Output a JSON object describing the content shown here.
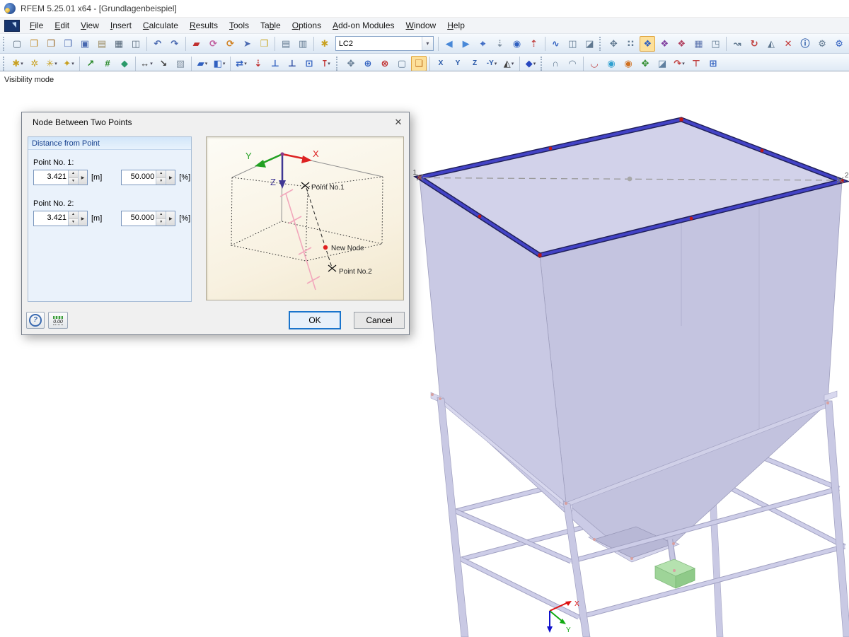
{
  "window": {
    "title": "RFEM 5.25.01 x64 - [Grundlagenbeispiel]"
  },
  "menu": {
    "items": [
      {
        "label": "File",
        "u": 0
      },
      {
        "label": "Edit",
        "u": 0
      },
      {
        "label": "View",
        "u": 0
      },
      {
        "label": "Insert",
        "u": 0
      },
      {
        "label": "Calculate",
        "u": 0
      },
      {
        "label": "Results",
        "u": 0
      },
      {
        "label": "Tools",
        "u": 0
      },
      {
        "label": "Table",
        "u": 2
      },
      {
        "label": "Options",
        "u": 0
      },
      {
        "label": "Add-on Modules",
        "u": 0
      },
      {
        "label": "Window",
        "u": 0
      },
      {
        "label": "Help",
        "u": 0
      }
    ]
  },
  "toolbars": {
    "load_case": "LC2",
    "row1": [
      {
        "t": "grip"
      },
      {
        "n": "new-model",
        "g": "▢",
        "c": "#56687a"
      },
      {
        "n": "open-model",
        "g": "❒",
        "c": "#c08a28"
      },
      {
        "n": "open-project-manager",
        "g": "❒",
        "c": "#9a6826"
      },
      {
        "n": "save-as-archive",
        "g": "❒",
        "c": "#4868b0"
      },
      {
        "n": "save",
        "g": "▣",
        "c": "#4868b0"
      },
      {
        "n": "page-setup",
        "g": "▤",
        "c": "#9a8a60"
      },
      {
        "n": "print",
        "g": "▦",
        "c": "#56687a"
      },
      {
        "n": "print-preview",
        "g": "◫",
        "c": "#56687a"
      },
      {
        "t": "sep"
      },
      {
        "n": "undo",
        "g": "↶",
        "c": "#4868b0"
      },
      {
        "n": "redo",
        "g": "↷",
        "c": "#4868b0"
      },
      {
        "t": "sep"
      },
      {
        "n": "select-by-window",
        "g": "▰",
        "c": "#c03030"
      },
      {
        "n": "rotate-view-mouse",
        "g": "⟳",
        "c": "#c060a0"
      },
      {
        "n": "rotate-view-axis",
        "g": "⟳",
        "c": "#d08020"
      },
      {
        "n": "pick-mode",
        "g": "➤",
        "c": "#4868b0"
      },
      {
        "n": "new-view-window",
        "g": "❒",
        "c": "#c8a828"
      },
      {
        "t": "sep"
      },
      {
        "n": "table-show",
        "g": "▤",
        "c": "#607890"
      },
      {
        "n": "table-position",
        "g": "▥",
        "c": "#607890"
      },
      {
        "t": "sep"
      },
      {
        "n": "new-load-case",
        "g": "✱",
        "c": "#c8a020"
      },
      {
        "t": "combo"
      },
      {
        "t": "sep"
      },
      {
        "n": "previous-load-case",
        "g": "◀",
        "c": "#4888d8"
      },
      {
        "n": "next-load-case",
        "g": "▶",
        "c": "#4888d8"
      },
      {
        "n": "show-loads",
        "g": "⌖",
        "c": "#3060c0"
      },
      {
        "n": "show-load-values",
        "g": "⇣",
        "c": "#8090a0"
      },
      {
        "n": "show-results",
        "g": "◉",
        "c": "#3060c0"
      },
      {
        "n": "show-result-values",
        "g": "⇡",
        "c": "#c04040"
      },
      {
        "t": "sep"
      },
      {
        "n": "member-releases",
        "g": "∿",
        "c": "#3060c0"
      },
      {
        "n": "display-properties",
        "g": "◫",
        "c": "#607890"
      },
      {
        "n": "comments",
        "g": "◪",
        "c": "#607890"
      },
      {
        "t": "grip"
      },
      {
        "n": "move-grab-mode",
        "g": "✥",
        "c": "#607890"
      },
      {
        "n": "snap-grid",
        "g": "∷",
        "c": "#607890"
      },
      {
        "n": "visibility-mode",
        "g": "❖",
        "c": "#3060c0",
        "hl": 1
      },
      {
        "n": "visibility-by-window",
        "g": "❖",
        "c": "#8040a0"
      },
      {
        "n": "visibility-inverted",
        "g": "❖",
        "c": "#b04060"
      },
      {
        "n": "visibility-by-numbering",
        "g": "▦",
        "c": "#6078b0"
      },
      {
        "n": "user-defined-visibility",
        "g": "◳",
        "c": "#607890"
      },
      {
        "t": "sep"
      },
      {
        "n": "select-objects",
        "g": "↝",
        "c": "#607890"
      },
      {
        "n": "rotate-about-node",
        "g": "↻",
        "c": "#c04040"
      },
      {
        "n": "mirror",
        "g": "◭",
        "c": "#607890"
      },
      {
        "n": "delete-objects",
        "g": "✕",
        "c": "#c03030"
      },
      {
        "n": "object-info",
        "g": "ⓘ",
        "c": "#2858a8"
      },
      {
        "n": "display-settings",
        "g": "⚙",
        "c": "#607890"
      },
      {
        "n": "program-options",
        "g": "⚙",
        "c": "#3060c0"
      }
    ],
    "row2": [
      {
        "t": "grip"
      },
      {
        "n": "new-node",
        "g": "✱",
        "c": "#c8a020",
        "dd": 1
      },
      {
        "n": "new-node-on-line",
        "g": "✲",
        "c": "#c8a020"
      },
      {
        "n": "divide-member",
        "g": "✳",
        "c": "#c8a020",
        "dd": 1
      },
      {
        "n": "node-between-two-points",
        "g": "✦",
        "c": "#c8a020",
        "dd": 1
      },
      {
        "t": "sep"
      },
      {
        "n": "new-member",
        "g": "↗",
        "c": "#2a8a2a"
      },
      {
        "n": "new-member-set",
        "g": "#",
        "c": "#2a8a2a"
      },
      {
        "n": "new-surface-from-members",
        "g": "◆",
        "c": "#2a9a6a"
      },
      {
        "t": "sep"
      },
      {
        "n": "new-dimension",
        "g": "↔",
        "c": "#404040",
        "dd": 1
      },
      {
        "n": "new-symbol",
        "g": "↘",
        "c": "#404040"
      },
      {
        "n": "edit-boundary",
        "g": "▧",
        "c": "#8090a0"
      },
      {
        "t": "sep"
      },
      {
        "n": "new-surface",
        "g": "▰",
        "c": "#3060c0",
        "dd": 1
      },
      {
        "n": "new-opening",
        "g": "◧",
        "c": "#3060c0",
        "dd": 1
      },
      {
        "t": "sep"
      },
      {
        "n": "move-copy",
        "g": "⇄",
        "c": "#3060c0",
        "dd": 1
      },
      {
        "n": "project-node-onto-line",
        "g": "⇣",
        "c": "#c03030"
      },
      {
        "n": "new-nodal-support",
        "g": "⊥",
        "c": "#3060c0"
      },
      {
        "n": "new-line-support",
        "g": "⊥",
        "c": "#2848a0"
      },
      {
        "n": "new-surface-support",
        "g": "⊡",
        "c": "#3060c0"
      },
      {
        "n": "new-column",
        "g": "⊺",
        "c": "#c03030",
        "dd": 1
      },
      {
        "t": "grip"
      },
      {
        "n": "walk-through-mode",
        "g": "✥",
        "c": "#607890"
      },
      {
        "n": "zoom-by-window",
        "g": "⊕",
        "c": "#3060c0"
      },
      {
        "n": "zoom-out",
        "g": "⊗",
        "c": "#c03030"
      },
      {
        "n": "show-wireframe",
        "g": "▢",
        "c": "#607890"
      },
      {
        "n": "work-plane-visibility",
        "g": "❏",
        "c": "#c07020",
        "hl": 1
      },
      {
        "t": "sep"
      },
      {
        "n": "view-in-x",
        "g": "X",
        "c": "#2858a8",
        "sm": 1
      },
      {
        "n": "view-in-y",
        "g": "Y",
        "c": "#2858a8",
        "sm": 1
      },
      {
        "n": "view-in-z",
        "g": "Z",
        "c": "#2858a8",
        "sm": 1
      },
      {
        "n": "view-in-minus-y",
        "g": "-Y",
        "c": "#2858a8",
        "sm": 1,
        "dd": 1
      },
      {
        "n": "isometric-view",
        "g": "◭",
        "c": "#404040",
        "dd": 1
      },
      {
        "t": "sep"
      },
      {
        "n": "rendering-mode",
        "g": "◆",
        "c": "#2848c0",
        "dd": 1
      },
      {
        "t": "grip"
      },
      {
        "n": "result-diagrams-on-members",
        "g": "∩",
        "c": "#607890"
      },
      {
        "n": "result-panel",
        "g": "◠",
        "c": "#607890"
      },
      {
        "t": "sep"
      },
      {
        "n": "show-deformation",
        "g": "◡",
        "c": "#c04040"
      },
      {
        "n": "panel-isobands",
        "g": "◉",
        "c": "#30a0d0"
      },
      {
        "n": "panel-isolines",
        "g": "◉",
        "c": "#d07020"
      },
      {
        "n": "result-vectors",
        "g": "✥",
        "c": "#2a8a2a"
      },
      {
        "n": "section",
        "g": "◪",
        "c": "#6080a0"
      },
      {
        "n": "generate-results",
        "g": "↷",
        "c": "#c04040",
        "dd": 1
      },
      {
        "n": "result-beam",
        "g": "⊤",
        "c": "#c04040"
      },
      {
        "n": "result-tables",
        "g": "⊞",
        "c": "#3060c0"
      }
    ]
  },
  "viewport": {
    "mode_label": "Visibility mode",
    "node1_label": "1",
    "node2_label": "2"
  },
  "dialog": {
    "title": "Node Between Two Points",
    "close_glyph": "✕",
    "group_title": "Distance from Point",
    "point1": {
      "label": "Point No. 1:",
      "distance": "3.421",
      "distance_unit": "[m]",
      "percent": "50.000",
      "percent_unit": "[%]"
    },
    "point2": {
      "label": "Point No. 2:",
      "distance": "3.421",
      "distance_unit": "[m]",
      "percent": "50.000",
      "percent_unit": "[%]"
    },
    "illustration": {
      "x_label": "X",
      "y_label": "Y",
      "z_label": "Z",
      "point1_label": "Point No.1",
      "new_node_label": "New Node",
      "point2_label": "Point No.2"
    },
    "buttons": {
      "ok": "OK",
      "cancel": "Cancel"
    },
    "units_button_text": "0.00"
  },
  "colors": {
    "selection_blue": "#4343c6",
    "surface_lavender": "#c9c9e4",
    "top_face": "#d2d2ea",
    "highlight_orange": "#fde09a",
    "support_green": "#b5e2af",
    "node_red": "#c01818",
    "toolbar_bg": "#dde8f4"
  }
}
